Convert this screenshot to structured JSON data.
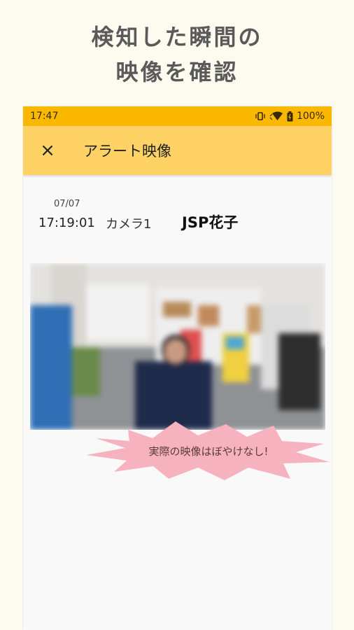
{
  "headline": {
    "line1": "検知した瞬間の",
    "line2": "映像を確認"
  },
  "status_bar": {
    "time": "17:47",
    "battery": "100%",
    "icons": [
      "vibrate-icon",
      "wifi-icon",
      "battery-icon"
    ]
  },
  "app_bar": {
    "close_icon": "×",
    "title": "アラート映像"
  },
  "alert": {
    "date": "07/07",
    "time": "17:19:01",
    "camera": "カメラ1",
    "person": "JSP花子"
  },
  "note": {
    "text": "実際の映像はぼやけなし!"
  },
  "colors": {
    "status_bar": "#fbb800",
    "app_bar": "#ffd266",
    "burst": "#f6b3bf",
    "background": "#fdfbef"
  }
}
